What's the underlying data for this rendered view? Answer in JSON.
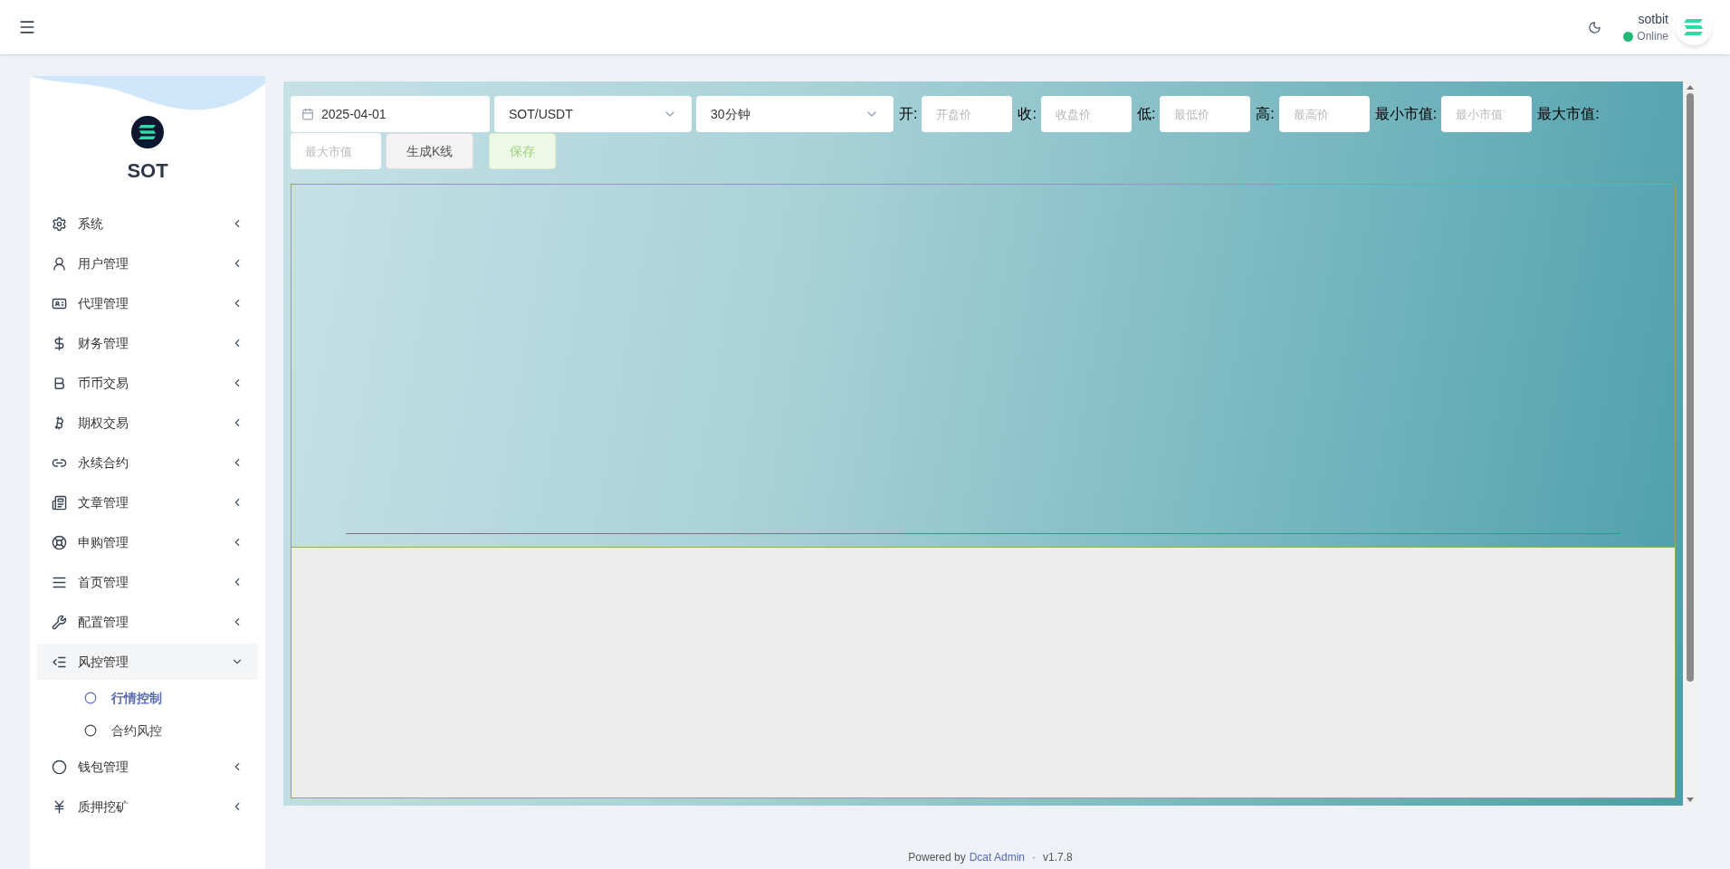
{
  "header": {
    "user": {
      "name": "sotbit",
      "status": "Online",
      "online": true
    }
  },
  "sidebar": {
    "brand": "SOT",
    "items": [
      {
        "label": "系统",
        "expanded": false
      },
      {
        "label": "用户管理",
        "expanded": false
      },
      {
        "label": "代理管理",
        "expanded": false
      },
      {
        "label": "财务管理",
        "expanded": false
      },
      {
        "label": "币币交易",
        "expanded": false
      },
      {
        "label": "期权交易",
        "expanded": false
      },
      {
        "label": "永续合约",
        "expanded": false
      },
      {
        "label": "文章管理",
        "expanded": false
      },
      {
        "label": "申购管理",
        "expanded": false
      },
      {
        "label": "首页管理",
        "expanded": false
      },
      {
        "label": "配置管理",
        "expanded": false
      },
      {
        "label": "风控管理",
        "expanded": true,
        "children": [
          {
            "label": "行情控制",
            "selected": true
          },
          {
            "label": "合约风控",
            "selected": false
          }
        ]
      },
      {
        "label": "钱包管理",
        "expanded": false
      },
      {
        "label": "质押挖矿",
        "expanded": false
      }
    ]
  },
  "toolbar": {
    "date": "2025-04-01",
    "pair": "SOT/USDT",
    "interval": "30分钟",
    "fields": [
      {
        "label": "开:",
        "placeholder": "开盘价"
      },
      {
        "label": "收:",
        "placeholder": "收盘价"
      },
      {
        "label": "低:",
        "placeholder": "最低价"
      },
      {
        "label": "高:",
        "placeholder": "最高价"
      },
      {
        "label": "最小市值:",
        "placeholder": "最小市值"
      },
      {
        "label": "最大市值:",
        "placeholder": "最大市值"
      }
    ],
    "buttons": [
      {
        "label": "生成K线",
        "kind": "default",
        "disabled": false
      },
      {
        "label": "保存",
        "kind": "success",
        "disabled": true
      }
    ]
  },
  "footer": {
    "prefix": "Powered by",
    "link": "Dcat Admin",
    "separator": "·",
    "version": "v1.7.8"
  }
}
